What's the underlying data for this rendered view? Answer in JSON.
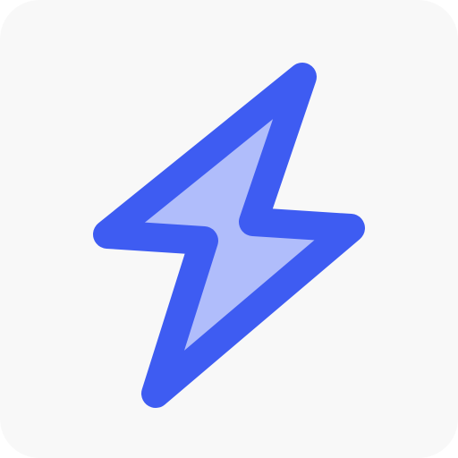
{
  "icon": {
    "name": "lightning-bolt-icon",
    "stroke_color": "#3e5cf2",
    "fill_color": "#b0bdfb",
    "background_color": "#f8f8f8"
  }
}
